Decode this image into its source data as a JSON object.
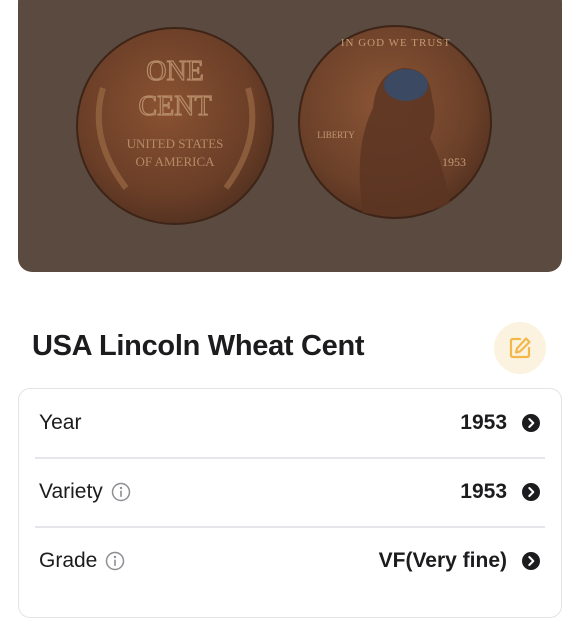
{
  "photo": {
    "coin_left": {
      "line1": "ONE",
      "line2": "CENT",
      "line3": "UNITED STATES",
      "line4": "OF AMERICA"
    },
    "coin_right": {
      "motto": "IN GOD WE TRUST",
      "liberty": "LIBERTY",
      "year": "1953"
    }
  },
  "title": "USA Lincoln Wheat Cent",
  "details": [
    {
      "label": "Year",
      "value": "1953",
      "info": false
    },
    {
      "label": "Variety",
      "value": "1953",
      "info": true
    },
    {
      "label": "Grade",
      "value": "VF(Very fine)",
      "info": true
    }
  ],
  "colors": {
    "photo_bg": "#5a4a40",
    "edit_bg": "#fbf3df",
    "edit_accent": "#f2b84b",
    "text": "#1c1c1e",
    "muted_icon": "#8e8e93"
  },
  "icons": {
    "edit": "edit-pencil-icon",
    "info": "info-circle-icon",
    "chevron": "chevron-right-circle-icon"
  }
}
